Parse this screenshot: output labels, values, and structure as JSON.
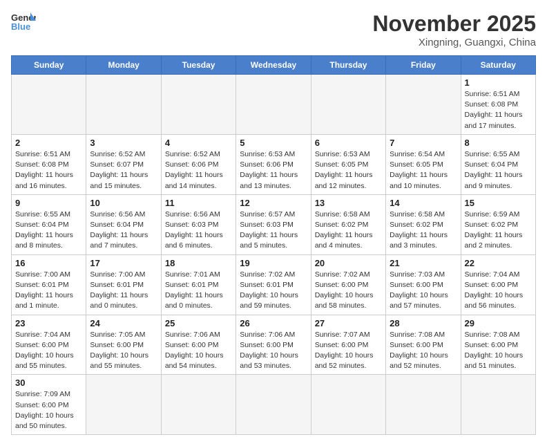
{
  "header": {
    "logo_general": "General",
    "logo_blue": "Blue",
    "month_year": "November 2025",
    "location": "Xingning, Guangxi, China"
  },
  "weekdays": [
    "Sunday",
    "Monday",
    "Tuesday",
    "Wednesday",
    "Thursday",
    "Friday",
    "Saturday"
  ],
  "weeks": [
    [
      {
        "day": "",
        "info": ""
      },
      {
        "day": "",
        "info": ""
      },
      {
        "day": "",
        "info": ""
      },
      {
        "day": "",
        "info": ""
      },
      {
        "day": "",
        "info": ""
      },
      {
        "day": "",
        "info": ""
      },
      {
        "day": "1",
        "info": "Sunrise: 6:51 AM\nSunset: 6:08 PM\nDaylight: 11 hours and 17 minutes."
      }
    ],
    [
      {
        "day": "2",
        "info": "Sunrise: 6:51 AM\nSunset: 6:08 PM\nDaylight: 11 hours and 16 minutes."
      },
      {
        "day": "3",
        "info": "Sunrise: 6:52 AM\nSunset: 6:07 PM\nDaylight: 11 hours and 15 minutes."
      },
      {
        "day": "4",
        "info": "Sunrise: 6:52 AM\nSunset: 6:06 PM\nDaylight: 11 hours and 14 minutes."
      },
      {
        "day": "5",
        "info": "Sunrise: 6:53 AM\nSunset: 6:06 PM\nDaylight: 11 hours and 13 minutes."
      },
      {
        "day": "6",
        "info": "Sunrise: 6:53 AM\nSunset: 6:05 PM\nDaylight: 11 hours and 12 minutes."
      },
      {
        "day": "7",
        "info": "Sunrise: 6:54 AM\nSunset: 6:05 PM\nDaylight: 11 hours and 10 minutes."
      },
      {
        "day": "8",
        "info": "Sunrise: 6:55 AM\nSunset: 6:04 PM\nDaylight: 11 hours and 9 minutes."
      }
    ],
    [
      {
        "day": "9",
        "info": "Sunrise: 6:55 AM\nSunset: 6:04 PM\nDaylight: 11 hours and 8 minutes."
      },
      {
        "day": "10",
        "info": "Sunrise: 6:56 AM\nSunset: 6:04 PM\nDaylight: 11 hours and 7 minutes."
      },
      {
        "day": "11",
        "info": "Sunrise: 6:56 AM\nSunset: 6:03 PM\nDaylight: 11 hours and 6 minutes."
      },
      {
        "day": "12",
        "info": "Sunrise: 6:57 AM\nSunset: 6:03 PM\nDaylight: 11 hours and 5 minutes."
      },
      {
        "day": "13",
        "info": "Sunrise: 6:58 AM\nSunset: 6:02 PM\nDaylight: 11 hours and 4 minutes."
      },
      {
        "day": "14",
        "info": "Sunrise: 6:58 AM\nSunset: 6:02 PM\nDaylight: 11 hours and 3 minutes."
      },
      {
        "day": "15",
        "info": "Sunrise: 6:59 AM\nSunset: 6:02 PM\nDaylight: 11 hours and 2 minutes."
      }
    ],
    [
      {
        "day": "16",
        "info": "Sunrise: 7:00 AM\nSunset: 6:01 PM\nDaylight: 11 hours and 1 minute."
      },
      {
        "day": "17",
        "info": "Sunrise: 7:00 AM\nSunset: 6:01 PM\nDaylight: 11 hours and 0 minutes."
      },
      {
        "day": "18",
        "info": "Sunrise: 7:01 AM\nSunset: 6:01 PM\nDaylight: 11 hours and 0 minutes."
      },
      {
        "day": "19",
        "info": "Sunrise: 7:02 AM\nSunset: 6:01 PM\nDaylight: 10 hours and 59 minutes."
      },
      {
        "day": "20",
        "info": "Sunrise: 7:02 AM\nSunset: 6:00 PM\nDaylight: 10 hours and 58 minutes."
      },
      {
        "day": "21",
        "info": "Sunrise: 7:03 AM\nSunset: 6:00 PM\nDaylight: 10 hours and 57 minutes."
      },
      {
        "day": "22",
        "info": "Sunrise: 7:04 AM\nSunset: 6:00 PM\nDaylight: 10 hours and 56 minutes."
      }
    ],
    [
      {
        "day": "23",
        "info": "Sunrise: 7:04 AM\nSunset: 6:00 PM\nDaylight: 10 hours and 55 minutes."
      },
      {
        "day": "24",
        "info": "Sunrise: 7:05 AM\nSunset: 6:00 PM\nDaylight: 10 hours and 55 minutes."
      },
      {
        "day": "25",
        "info": "Sunrise: 7:06 AM\nSunset: 6:00 PM\nDaylight: 10 hours and 54 minutes."
      },
      {
        "day": "26",
        "info": "Sunrise: 7:06 AM\nSunset: 6:00 PM\nDaylight: 10 hours and 53 minutes."
      },
      {
        "day": "27",
        "info": "Sunrise: 7:07 AM\nSunset: 6:00 PM\nDaylight: 10 hours and 52 minutes."
      },
      {
        "day": "28",
        "info": "Sunrise: 7:08 AM\nSunset: 6:00 PM\nDaylight: 10 hours and 52 minutes."
      },
      {
        "day": "29",
        "info": "Sunrise: 7:08 AM\nSunset: 6:00 PM\nDaylight: 10 hours and 51 minutes."
      }
    ],
    [
      {
        "day": "30",
        "info": "Sunrise: 7:09 AM\nSunset: 6:00 PM\nDaylight: 10 hours and 50 minutes."
      },
      {
        "day": "",
        "info": ""
      },
      {
        "day": "",
        "info": ""
      },
      {
        "day": "",
        "info": ""
      },
      {
        "day": "",
        "info": ""
      },
      {
        "day": "",
        "info": ""
      },
      {
        "day": "",
        "info": ""
      }
    ]
  ]
}
